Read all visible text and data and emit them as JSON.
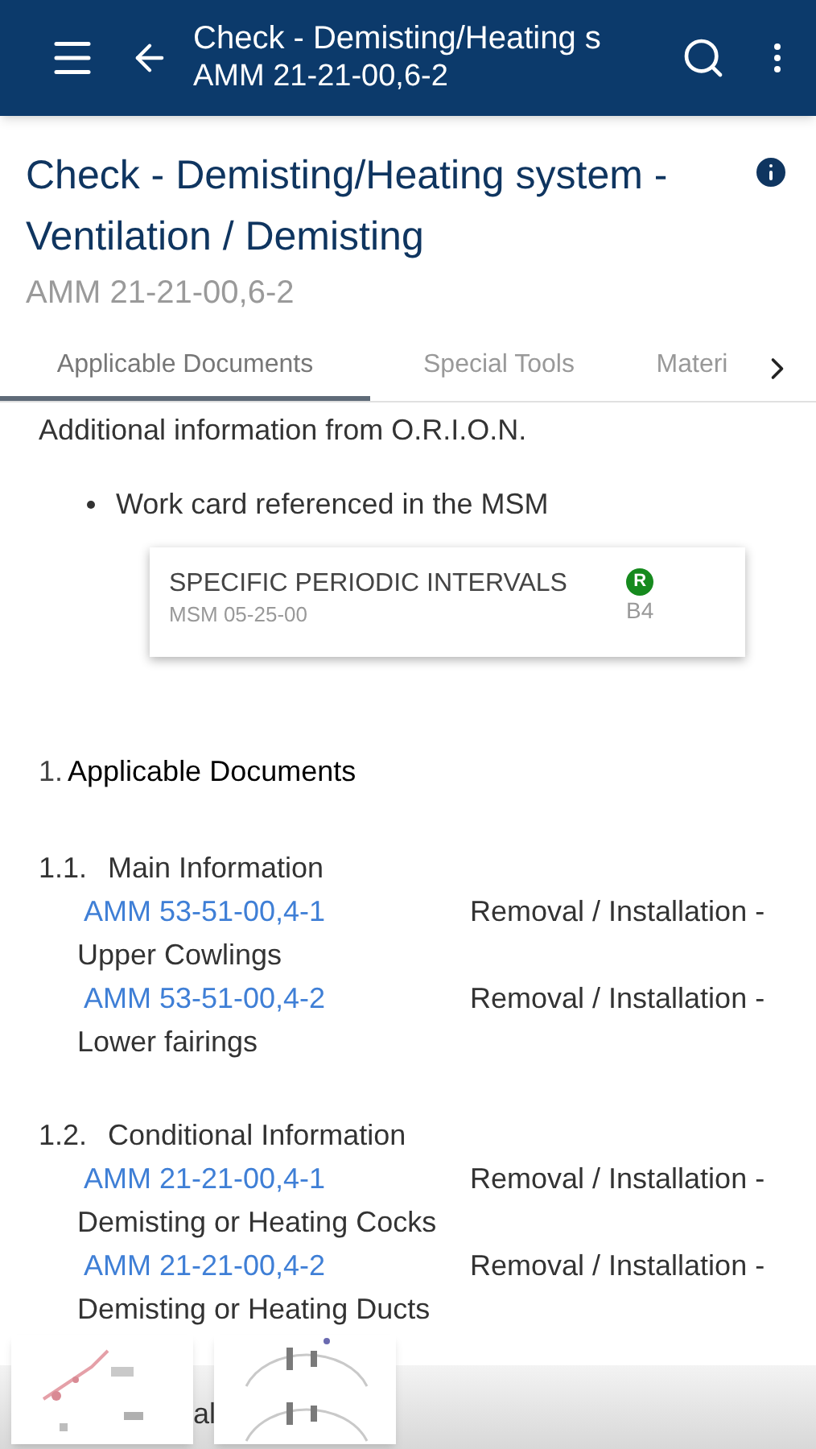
{
  "app_bar": {
    "title": "Check - Demisting/Heating s",
    "subtitle": "AMM 21-21-00,6-2"
  },
  "heading": {
    "title": "Check - Demisting/Heating system - Ventilation / Demisting",
    "reference": "AMM 21-21-00,6-2"
  },
  "tabs": [
    {
      "label": "Applicable Documents",
      "selected": true
    },
    {
      "label": "Special Tools",
      "selected": false
    },
    {
      "label": "Materi",
      "selected": false
    }
  ],
  "content": {
    "intro": "Additional information from O.R.I.O.N.",
    "bullet": "Work card referenced in the MSM",
    "work_card": {
      "title": "SPECIFIC PERIODIC INTERVALS",
      "reference": "MSM 05-25-00",
      "badge": "R",
      "code": "B4"
    },
    "section": {
      "number": "1.",
      "title": "Applicable Documents"
    },
    "subsections": [
      {
        "number": "1.1.",
        "title": "Main Information",
        "documents": [
          {
            "link": "AMM 53-51-00,4-1",
            "description_line_1": "Removal / Installation -",
            "description_line_2": "Upper Cowlings"
          },
          {
            "link": "AMM 53-51-00,4-2",
            "description_line_1": "Removal / Installation -",
            "description_line_2": "Lower fairings"
          }
        ]
      },
      {
        "number": "1.2.",
        "title": "Conditional Information",
        "documents": [
          {
            "link": "AMM 21-21-00,4-1",
            "description_line_1": "Removal / Installation -",
            "description_line_2": "Demisting or Heating Cocks"
          },
          {
            "link": "AMM 21-21-00,4-2",
            "description_line_1": "Removal / Installation -",
            "description_line_2": "Demisting or Heating Ducts"
          }
        ]
      }
    ]
  },
  "bottom_strip": {
    "fragment": "al"
  }
}
